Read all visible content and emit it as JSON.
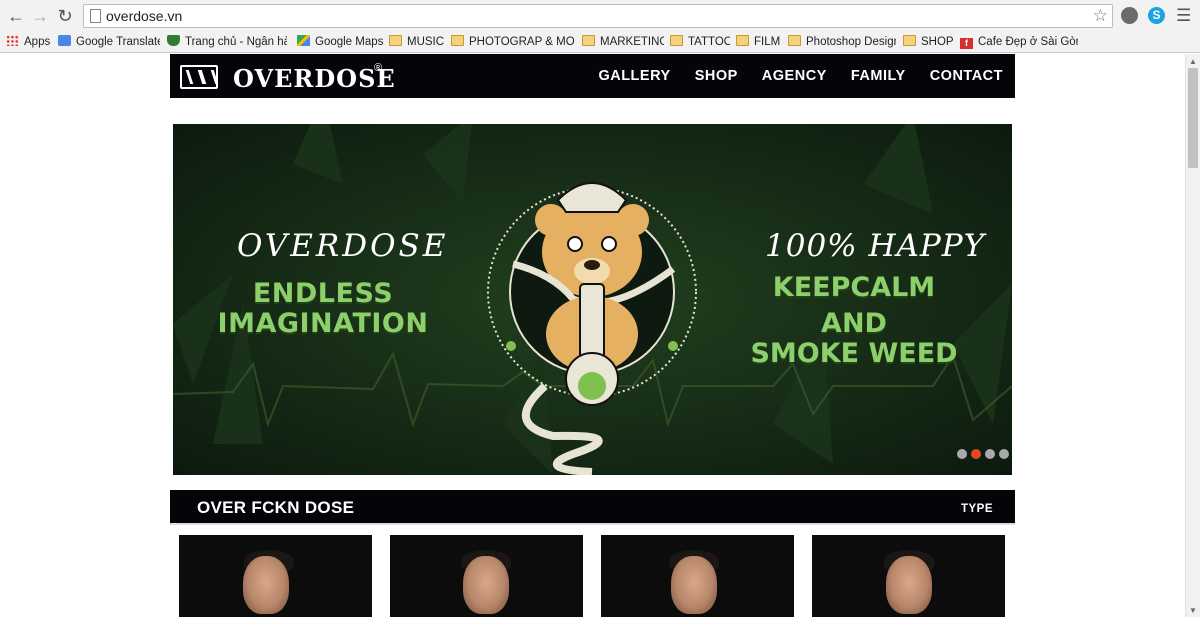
{
  "browser": {
    "url": "overdose.vn",
    "bookmarks": [
      {
        "label": "Apps",
        "icon": "apps-icon"
      },
      {
        "label": "Google Translate",
        "icon": "google-translate-icon"
      },
      {
        "label": "Trang chủ - Ngân hàn",
        "icon": "shield-icon"
      },
      {
        "label": "Google Maps",
        "icon": "maps-icon"
      },
      {
        "label": "MUSIC",
        "icon": "folder-icon"
      },
      {
        "label": "PHOTOGRAP & MONI",
        "icon": "folder-icon"
      },
      {
        "label": "MARKETING",
        "icon": "folder-icon"
      },
      {
        "label": "TATTOO",
        "icon": "folder-icon"
      },
      {
        "label": "FILM",
        "icon": "folder-icon"
      },
      {
        "label": "Photoshop Design",
        "icon": "folder-icon"
      },
      {
        "label": "SHOP",
        "icon": "folder-icon"
      },
      {
        "label": "Cafe Đẹp ở Sài Gòn -",
        "icon": "cafe-icon"
      }
    ]
  },
  "site": {
    "logo_text": "OVERDOSE",
    "logo_registered": "®",
    "nav": [
      "GALLERY",
      "SHOP",
      "AGENCY",
      "FAMILY",
      "CONTACT"
    ]
  },
  "slider": {
    "left_brand": "OVERDOSE",
    "left_tagline": [
      "ENDLESS",
      "IMAGINATION"
    ],
    "right_heading": "100% HAPPY",
    "right_tagline": [
      "KEEPCALM",
      "AND",
      "SMOKE WEED"
    ],
    "dots_count": 4,
    "active_dot": 2,
    "colors": {
      "accent_green": "#8ccf6b",
      "dot_active": "#e04a22"
    }
  },
  "section": {
    "title": "OVER FCKN DOSE",
    "filter_label": "TYPE"
  },
  "gallery": {
    "cards": 4
  }
}
